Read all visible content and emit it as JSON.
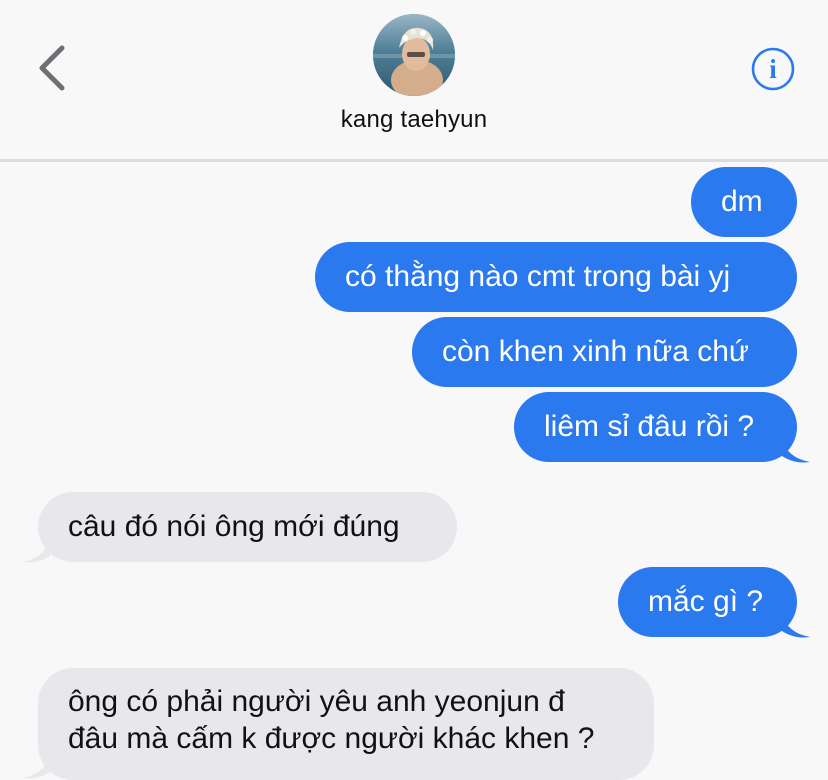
{
  "header": {
    "contact_name": "kang taehyun",
    "accent_color": "#2a79ee"
  },
  "messages": [
    {
      "direction": "sent",
      "text": "dm"
    },
    {
      "direction": "sent",
      "text": "có thằng nào cmt trong bài yj"
    },
    {
      "direction": "sent",
      "text": "còn khen xinh nữa chứ"
    },
    {
      "direction": "sent",
      "text": "liêm sỉ đâu rồi ?"
    },
    {
      "direction": "received",
      "text": "câu đó nói ông mới đúng"
    },
    {
      "direction": "sent",
      "text": "mắc gì ?"
    },
    {
      "direction": "received",
      "lines": [
        "ông có phải người yêu anh yeonjun đ",
        "đâu mà cấm k được người khác khen ?"
      ]
    }
  ],
  "colors": {
    "sent_bubble": "#2a79ee",
    "received_bubble": "#e8e8ec",
    "background": "#f8f8f9"
  }
}
